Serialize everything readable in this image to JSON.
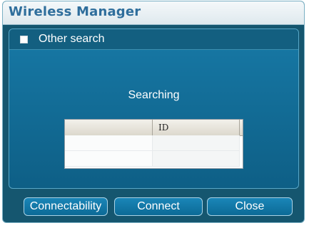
{
  "window": {
    "title": "Wireless Manager"
  },
  "search": {
    "checkbox_label": "Other search",
    "checked": false
  },
  "status": {
    "text": "Searching"
  },
  "table": {
    "columns": [
      "",
      "ID",
      ""
    ],
    "rows": [
      [
        "",
        ""
      ],
      [
        "",
        ""
      ]
    ]
  },
  "buttons": {
    "connectability": "Connectability",
    "connect": "Connect",
    "close": "Close"
  },
  "colors": {
    "panel": "#1779a6",
    "window_bg": "#15566f",
    "title_text": "#2f6e9c"
  }
}
